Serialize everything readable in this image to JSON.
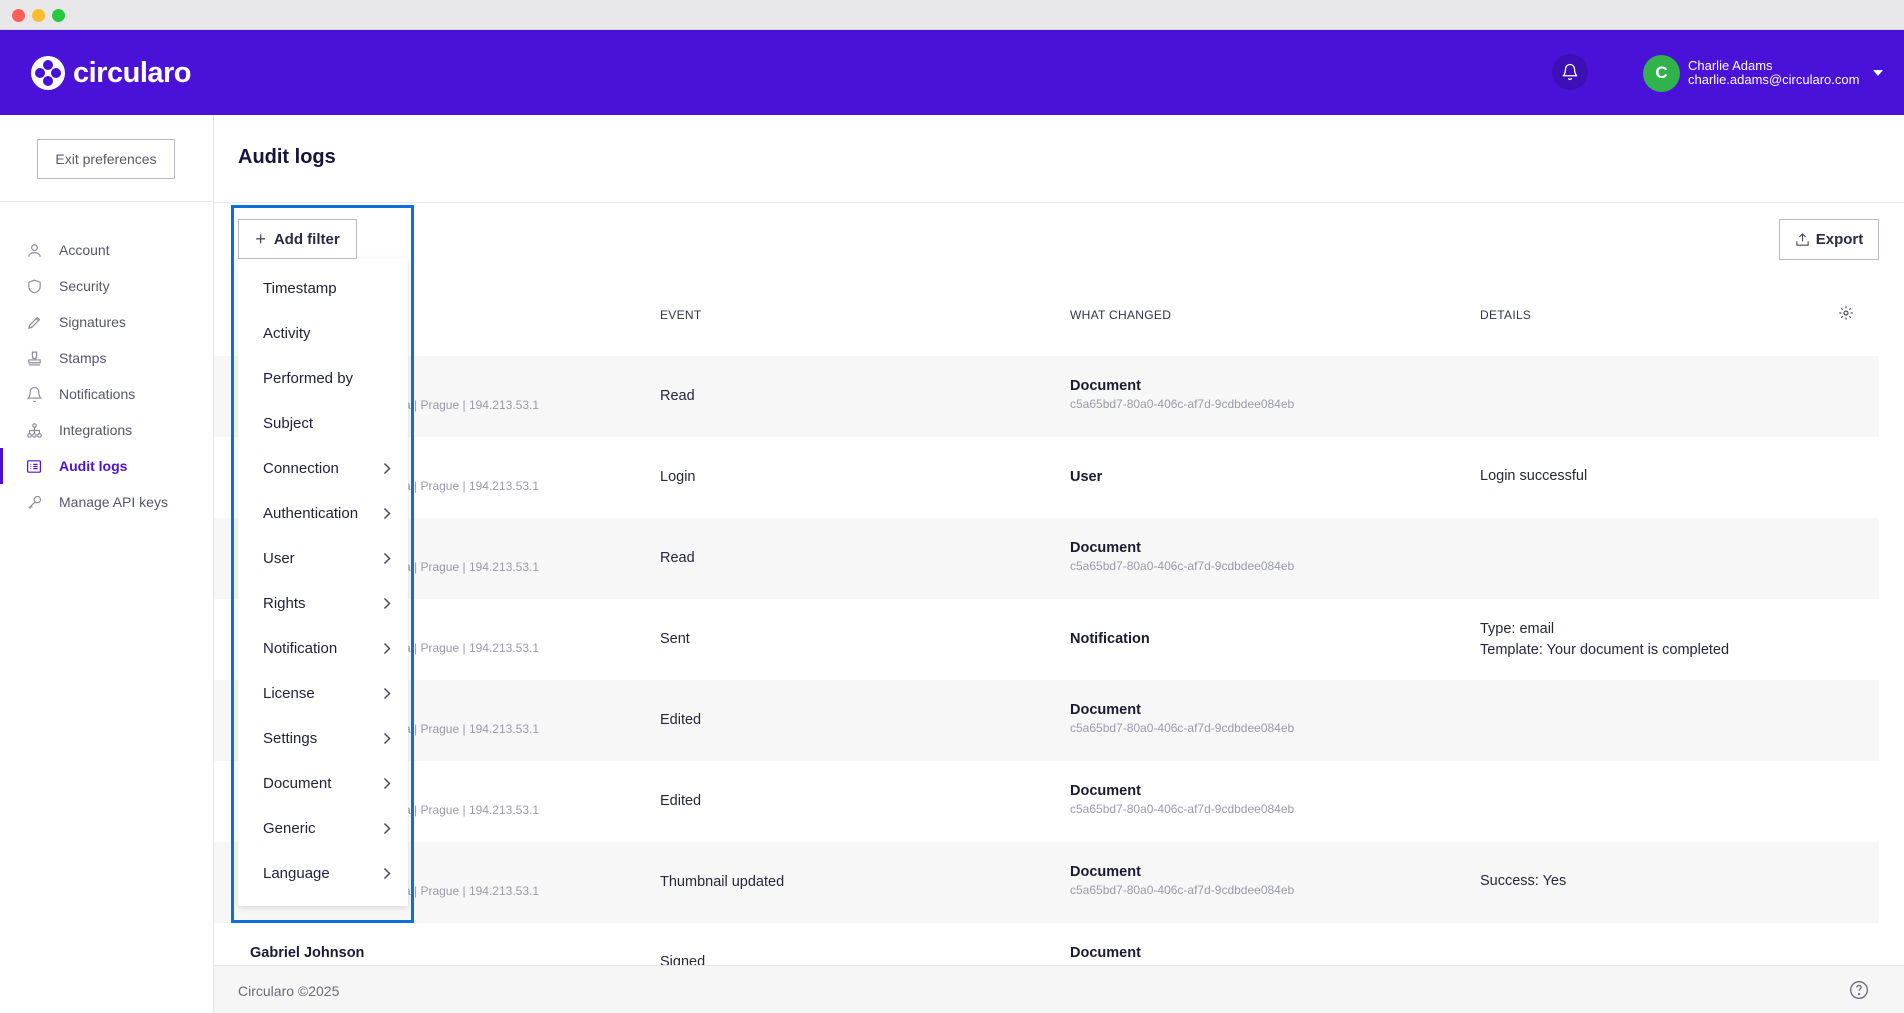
{
  "app": {
    "name": "circularo",
    "copyright": "Circularo ©2025"
  },
  "colors": {
    "brand": "#4a11d8",
    "avatar": "#2fb34a",
    "highlight": "#0a6fd6"
  },
  "header": {
    "user_initial": "C",
    "user_name": "Charlie Adams",
    "user_email": "charlie.adams@circularo.com"
  },
  "sidebar": {
    "exit_label": "Exit preferences",
    "items": [
      {
        "label": "Account",
        "icon": "user-icon"
      },
      {
        "label": "Security",
        "icon": "shield-icon"
      },
      {
        "label": "Signatures",
        "icon": "pen-icon"
      },
      {
        "label": "Stamps",
        "icon": "stamp-icon"
      },
      {
        "label": "Notifications",
        "icon": "bell-icon"
      },
      {
        "label": "Integrations",
        "icon": "network-icon"
      },
      {
        "label": "Audit logs",
        "icon": "list-icon",
        "active": true
      },
      {
        "label": "Manage API keys",
        "icon": "key-icon"
      }
    ]
  },
  "main": {
    "title": "Audit logs",
    "add_filter_label": "Add filter",
    "export_label": "Export",
    "columns": {
      "event": "EVENT",
      "what_changed": "WHAT CHANGED",
      "details": "DETAILS"
    },
    "rows": [
      {
        "location": "a | Prague | 194.213.53.1",
        "event": "Read",
        "what": "Document",
        "what_id": "c5a65bd7-80a0-406c-af7d-9cdbdee084eb",
        "details": [
          "",
          ""
        ]
      },
      {
        "location": "a | Prague | 194.213.53.1",
        "event": "Login",
        "what": "User",
        "what_id": "",
        "details": [
          "Login successful",
          ""
        ]
      },
      {
        "location": "a | Prague | 194.213.53.1",
        "event": "Read",
        "what": "Document",
        "what_id": "c5a65bd7-80a0-406c-af7d-9cdbdee084eb",
        "details": [
          "",
          ""
        ]
      },
      {
        "location": "a | Prague | 194.213.53.1",
        "event": "Sent",
        "what": "Notification",
        "what_id": "",
        "details": [
          "Type: email",
          "Template: Your document is completed"
        ]
      },
      {
        "location": "a | Prague | 194.213.53.1",
        "event": "Edited",
        "what": "Document",
        "what_id": "c5a65bd7-80a0-406c-af7d-9cdbdee084eb",
        "details": [
          "",
          ""
        ]
      },
      {
        "location": "a | Prague | 194.213.53.1",
        "event": "Edited",
        "what": "Document",
        "what_id": "c5a65bd7-80a0-406c-af7d-9cdbdee084eb",
        "details": [
          "",
          ""
        ]
      },
      {
        "location": "a | Prague | 194.213.53.1",
        "event": "Thumbnail updated",
        "what": "Document",
        "what_id": "c5a65bd7-80a0-406c-af7d-9cdbdee084eb",
        "details": [
          "Success: Yes",
          ""
        ]
      }
    ],
    "partial_row": {
      "person": "Gabriel Johnson",
      "event": "Signed",
      "what": "Document"
    }
  },
  "filter_menu": {
    "items": [
      {
        "label": "Timestamp",
        "submenu": false
      },
      {
        "label": "Activity",
        "submenu": false
      },
      {
        "label": "Performed by",
        "submenu": false
      },
      {
        "label": "Subject",
        "submenu": false
      },
      {
        "label": "Connection",
        "submenu": true
      },
      {
        "label": "Authentication",
        "submenu": true
      },
      {
        "label": "User",
        "submenu": true
      },
      {
        "label": "Rights",
        "submenu": true
      },
      {
        "label": "Notification",
        "submenu": true
      },
      {
        "label": "License",
        "submenu": true
      },
      {
        "label": "Settings",
        "submenu": true
      },
      {
        "label": "Document",
        "submenu": true
      },
      {
        "label": "Generic",
        "submenu": true
      },
      {
        "label": "Language",
        "submenu": true
      }
    ]
  }
}
